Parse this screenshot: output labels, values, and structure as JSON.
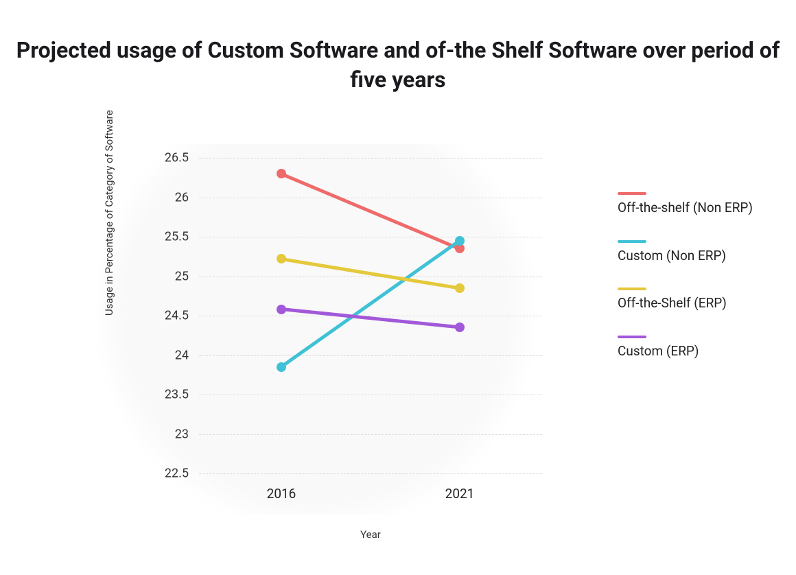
{
  "chart_data": {
    "type": "line",
    "title": "Projected usage of Custom Software and of-the Shelf Software over period of five years",
    "xlabel": "Year",
    "ylabel": "Usage in Percentage of Category of Software",
    "x_categories": [
      "2016",
      "2021"
    ],
    "y_ticks": [
      22.5,
      23,
      23.5,
      24,
      24.5,
      25,
      25.5,
      26,
      26.5
    ],
    "ylim": [
      22.5,
      26.5
    ],
    "series": [
      {
        "name": "Off-the-shelf (Non ERP)",
        "color": "#ef6b6b",
        "values": [
          26.3,
          25.35
        ]
      },
      {
        "name": "Custom (Non ERP)",
        "color": "#3fc1d6",
        "values": [
          23.85,
          25.45
        ]
      },
      {
        "name": "Off-the-Shelf (ERP)",
        "color": "#e4c93c",
        "values": [
          25.22,
          24.85
        ]
      },
      {
        "name": "Custom (ERP)",
        "color": "#a259d9",
        "values": [
          24.58,
          24.35
        ]
      }
    ],
    "legend_position": "right",
    "grid": true
  }
}
